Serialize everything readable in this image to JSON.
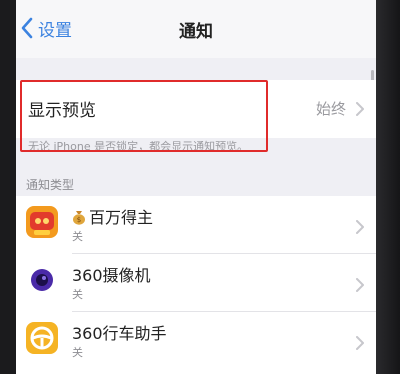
{
  "nav": {
    "back_label": "设置",
    "title": "通知"
  },
  "preview": {
    "label": "显示预览",
    "value": "始终",
    "footer": "无论 iPhone 是否锁定，都会显示通知预览。"
  },
  "section_header": "通知类型",
  "apps": [
    {
      "name": "百万得主",
      "status": "关",
      "icon": "money-bag-icon"
    },
    {
      "name": "360摄像机",
      "status": "关",
      "icon": "camera-app-icon"
    },
    {
      "name": "360行车助手",
      "status": "关",
      "icon": "steering-wheel-icon"
    }
  ],
  "colors": {
    "accent": "#3b82e0",
    "highlight": "#e02b2b",
    "background": "#efeff4"
  }
}
